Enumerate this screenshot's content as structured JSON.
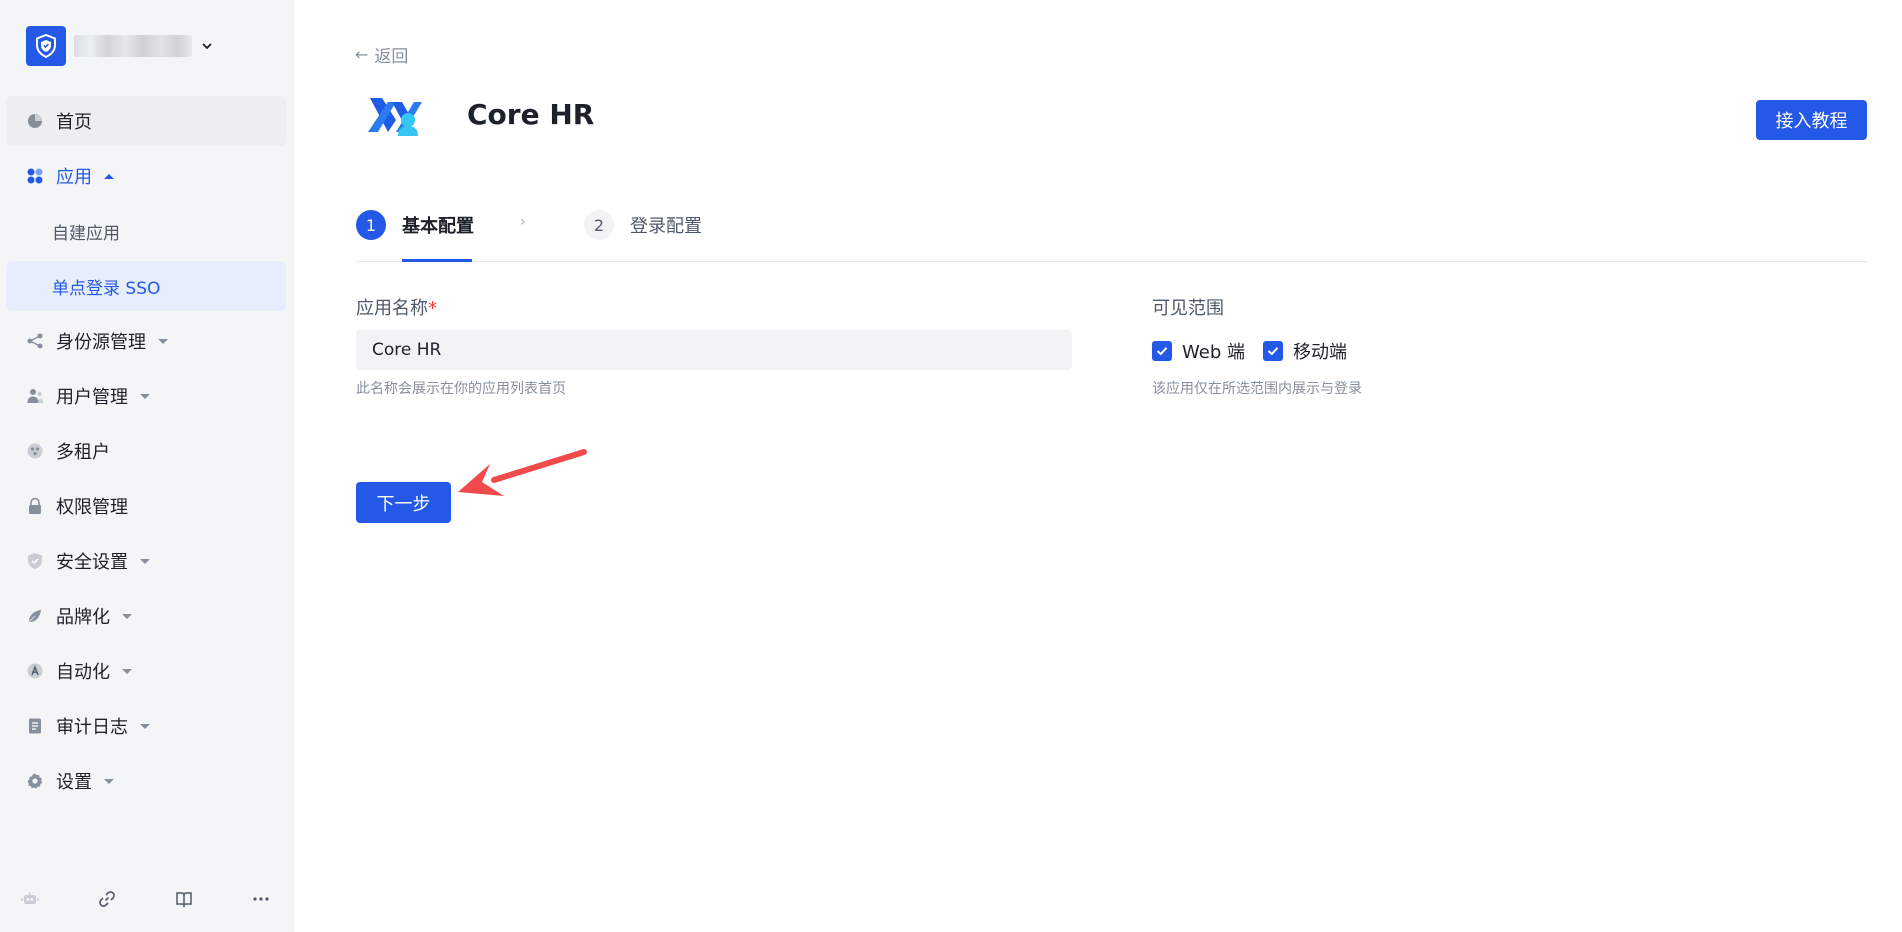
{
  "sidebar": {
    "nav": {
      "home": "首页",
      "apps": "应用",
      "apps_sub": {
        "custom": "自建应用",
        "sso": "单点登录 SSO"
      },
      "identity": "身份源管理",
      "users": "用户管理",
      "tenants": "多租户",
      "permissions": "权限管理",
      "security": "安全设置",
      "branding": "品牌化",
      "automation": "自动化",
      "audit": "审计日志",
      "settings": "设置"
    }
  },
  "header": {
    "back_label": "返回",
    "app_name": "Core HR",
    "tutorial_button": "接入教程"
  },
  "steps": [
    {
      "number": "1",
      "label": "基本配置"
    },
    {
      "number": "2",
      "label": "登录配置"
    }
  ],
  "form": {
    "app_name_label": "应用名称",
    "required_mark": "*",
    "app_name_value": "Core HR",
    "app_name_hint": "此名称会展示在你的应用列表首页",
    "visibility_label": "可见范围",
    "visibility_options": [
      {
        "label": "Web 端",
        "checked": true
      },
      {
        "label": "移动端",
        "checked": true
      }
    ],
    "visibility_hint": "该应用仅在所选范围内展示与登录",
    "next_button": "下一步"
  },
  "colors": {
    "primary": "#2458e6",
    "annotation_arrow": "#f04a4a"
  }
}
